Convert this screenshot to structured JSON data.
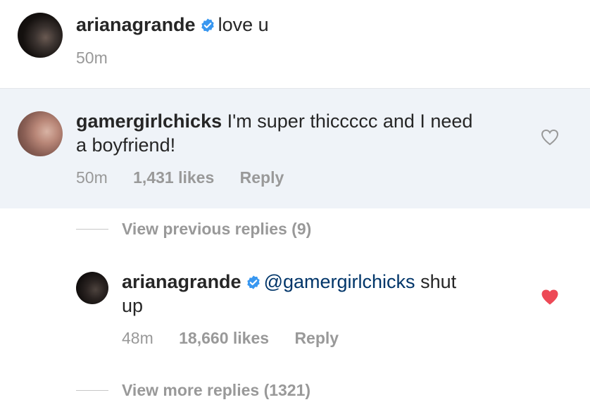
{
  "caption": {
    "username": "arianagrande",
    "verified": true,
    "text": "love u",
    "time": "50m"
  },
  "comment": {
    "username": "gamergirlchicks",
    "text_line1": "I'm super thiccccc and I need",
    "text_line2": "a boyfriend!",
    "time": "50m",
    "likes": "1,431 likes",
    "reply_label": "Reply",
    "liked": false
  },
  "view_previous": "View previous replies (9)",
  "reply": {
    "username": "arianagrande",
    "verified": true,
    "mention": "@gamergirlchicks",
    "text_rest": "shut",
    "text_line2": "up",
    "time": "48m",
    "likes": "18,660 likes",
    "reply_label": "Reply",
    "liked": true
  },
  "view_more": "View more replies (1321)",
  "colors": {
    "verified_blue": "#3897f0",
    "liked_red": "#ed4956",
    "highlight_bg": "#eff3f8",
    "meta_gray": "#999999",
    "mention_blue": "#003569"
  },
  "icons": {
    "verified": "verified-badge-icon",
    "heart_outline": "heart-outline-icon",
    "heart_filled": "heart-filled-icon"
  }
}
